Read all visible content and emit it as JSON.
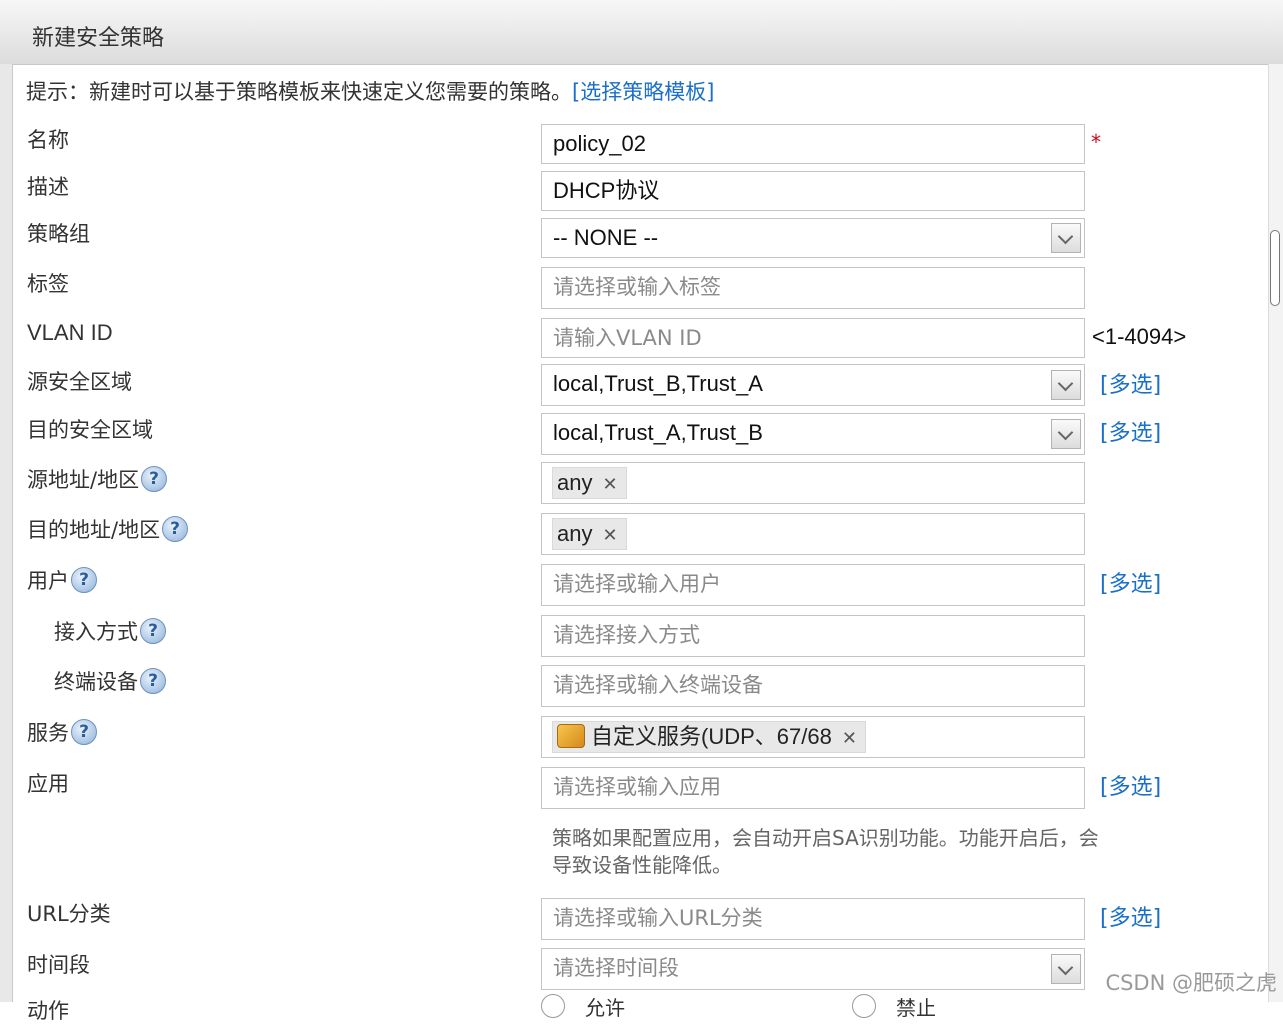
{
  "dialog": {
    "title": "新建安全策略"
  },
  "hint": {
    "text": "提示：新建时可以基于策略模板来快速定义您需要的策略。",
    "link": "[选择策略模板]"
  },
  "form": {
    "name": {
      "label": "名称",
      "value": "policy_02",
      "required": "*"
    },
    "description": {
      "label": "描述",
      "value": "DHCP协议"
    },
    "policy_group": {
      "label": "策略组",
      "value": "-- NONE --"
    },
    "tags": {
      "label": "标签",
      "placeholder": "请选择或输入标签"
    },
    "vlan_id": {
      "label": "VLAN ID",
      "placeholder": "请输入VLAN ID",
      "range": "<1-4094>"
    },
    "source_zone": {
      "label": "源安全区域",
      "value": "local,Trust_B,Trust_A",
      "multi": "[多选]"
    },
    "dest_zone": {
      "label": "目的安全区域",
      "value": "local,Trust_A,Trust_B",
      "multi": "[多选]"
    },
    "source_address": {
      "label": "源地址/地区",
      "tag": "any"
    },
    "dest_address": {
      "label": "目的地址/地区",
      "tag": "any"
    },
    "user": {
      "label": "用户",
      "placeholder": "请选择或输入用户",
      "multi": "[多选]"
    },
    "access_mode": {
      "label": "接入方式",
      "placeholder": "请选择接入方式"
    },
    "terminal_device": {
      "label": "终端设备",
      "placeholder": "请选择或输入终端设备"
    },
    "service": {
      "label": "服务",
      "tag": "自定义服务(UDP、67/68"
    },
    "application": {
      "label": "应用",
      "placeholder": "请选择或输入应用",
      "multi": "[多选]",
      "note": "策略如果配置应用，会自动开启SA识别功能。功能开启后，会导致设备性能降低。"
    },
    "url_category": {
      "label": "URL分类",
      "placeholder": "请选择或输入URL分类",
      "multi": "[多选]"
    },
    "time_range": {
      "label": "时间段",
      "placeholder": "请选择时间段"
    },
    "action": {
      "label": "动作",
      "options": [
        "允许",
        "禁止"
      ]
    }
  },
  "help_icon": "?",
  "remove_icon": "✕",
  "watermark": "CSDN @肥硕之虎"
}
